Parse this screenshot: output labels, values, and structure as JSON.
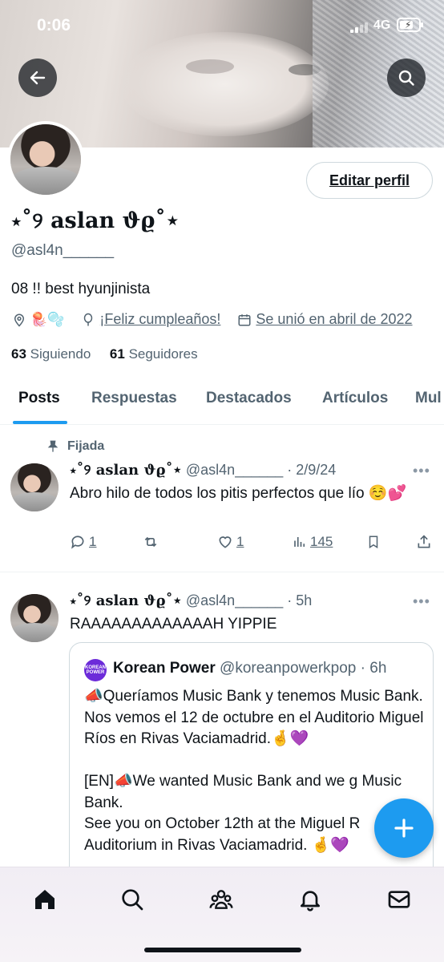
{
  "status_bar": {
    "time": "0:06",
    "network": "4G"
  },
  "profile": {
    "display_name": "⋆˚୨ aslan ϑϱ˚⋆",
    "handle": "@asl4n______",
    "bio": "08 !! best hyunjinista",
    "location": "🪼🫧",
    "birthday": "¡Feliz cumpleaños!",
    "joined": "Se unió en abril de 2022",
    "following_count": "63",
    "following_label": "Siguiendo",
    "followers_count": "61",
    "followers_label": "Seguidores",
    "edit_label": "Editar perfil"
  },
  "tabs": [
    {
      "label": "Posts",
      "active": true
    },
    {
      "label": "Respuestas"
    },
    {
      "label": "Destacados"
    },
    {
      "label": "Artículos"
    },
    {
      "label": "Mul"
    }
  ],
  "posts": [
    {
      "pinned_label": "Fijada",
      "name": "⋆˚୨ aslan ϑϱ˚⋆",
      "handle": "@asl4n______",
      "time": "· 2/9/24",
      "text": "Abro hilo de todos los pitis perfectos que lío ☺️💕",
      "replies": "1",
      "likes": "1",
      "views": "145"
    },
    {
      "name": "⋆˚୨ aslan ϑϱ˚⋆",
      "handle": "@asl4n______",
      "time": "· 5h",
      "text": "RAAAAAAAAAAAAAH YIPPIE",
      "quote": {
        "logo_text": "KOREAN POWER",
        "name": "Korean Power",
        "handle": "@koreanpowerkpop",
        "time": "· 6h",
        "text": "📣Queríamos Music Bank y tenemos Music Bank.\nNos vemos el 12 de octubre en el Auditorio Miguel Ríos en Rivas Vaciamadrid.🤞💜\n\n[EN]📣We wanted Music Bank and we g Music Bank.\nSee you on October 12th at the Miguel R Auditorium in Rivas Vaciamadrid. 🤞💜"
      }
    }
  ],
  "colors": {
    "accent": "#1d9bf0",
    "secondary_text": "#536471",
    "primary_text": "#0f1419"
  },
  "icons": [
    "back-arrow-icon",
    "search-icon",
    "location-icon",
    "balloon-icon",
    "calendar-icon",
    "pin-icon",
    "reply-icon",
    "retweet-icon",
    "like-icon",
    "views-icon",
    "bookmark-icon",
    "share-icon",
    "compose-plus-icon",
    "home-icon",
    "communities-icon",
    "bell-icon",
    "mail-icon"
  ]
}
